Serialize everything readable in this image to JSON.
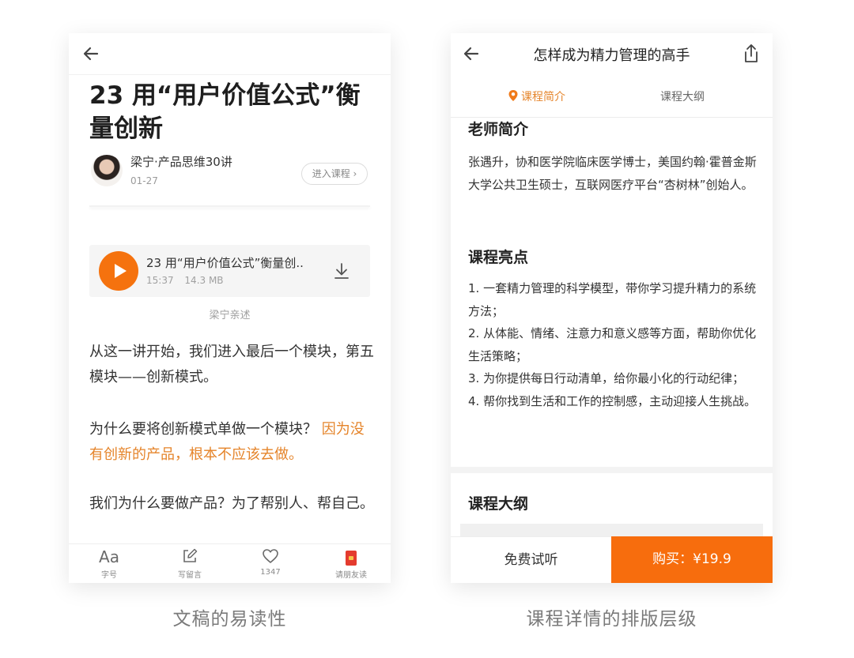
{
  "left_screen": {
    "article_title": "23 用“用户价值公式”衡量创新",
    "author": "梁宁·产品思维30讲",
    "date": "01-27",
    "enter_course_label": "进入课程 ›",
    "audio": {
      "title": "23 用“用户价值公式”衡量创..",
      "duration": "15:37",
      "size": "14.3 MB"
    },
    "narrator": "梁宁亲述",
    "paragraph1": "从这一讲开始，我们进入最后一个模块，第五模块——创新模式。",
    "paragraph2_plain": "为什么要将创新模式单做一个模块？",
    "paragraph2_highlight": "因为没有创新的产品，根本不应该去做。",
    "paragraph3": "我们为什么要做产品？为了帮别人、帮自己。",
    "toolbar": {
      "font_icon": "Aa",
      "font_label": "字号",
      "comment_label": "写留言",
      "like_count": "1347",
      "invite_label": "请朋友读"
    }
  },
  "right_screen": {
    "header_title": "怎样成为精力管理的高手",
    "tabs": [
      {
        "label": "课程简介",
        "active": true
      },
      {
        "label": "课程大纲",
        "active": false
      }
    ],
    "teacher_section_title": "老师简介",
    "teacher_text": "张遇升，协和医学院临床医学博士，美国约翰·霍普金斯大学公共卫生硕士，互联网医疗平台“杏树林”创始人。",
    "highlights_section_title": "课程亮点",
    "highlights": [
      "1. 一套精力管理的科学模型，带你学习提升精力的系统方法；",
      "2. 从体能、情绪、注意力和意义感等方面，帮助你优化生活策略；",
      "3. 为你提供每日行动清单，给你最小化的行动纪律；",
      "4. 帮你找到生活和工作的控制感，主动迎接人生挑战。"
    ],
    "outline_section_title": "课程大纲",
    "trial_label": "免费试听",
    "buy_label": "购买：¥19.9"
  },
  "captions": {
    "left": "文稿的易读性",
    "right": "课程详情的排版层级"
  },
  "colors": {
    "accent": "#f76d0d",
    "highlight_text": "#e5842a",
    "invite_icon": "#e43b2e"
  },
  "icons": [
    "back-arrow-icon",
    "download-icon",
    "play-icon",
    "font-size-icon",
    "edit-icon",
    "heart-icon",
    "red-envelope-icon",
    "share-icon",
    "location-pin-icon"
  ]
}
